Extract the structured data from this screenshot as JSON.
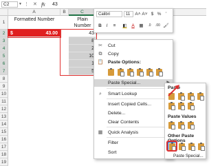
{
  "formula_bar": {
    "name_box": "C2",
    "fx": "fx",
    "value": "43"
  },
  "columns": [
    "A",
    "B",
    "C"
  ],
  "rows": [
    "1",
    "2",
    "3",
    "4",
    "5",
    "6",
    "7",
    "8",
    "9",
    "10",
    "11",
    "12",
    "13",
    "14",
    "15",
    "16",
    "17",
    "18",
    "19"
  ],
  "headers": {
    "formatted": "Formatted Number",
    "plain": "Plain Number"
  },
  "column_a": {
    "currency": "$",
    "value": "43.00"
  },
  "column_c_values": [
    "43",
    "8",
    "2",
    "10",
    "1",
    "5"
  ],
  "mini_toolbar": {
    "font": "Calibri",
    "size": "11",
    "buttons": [
      "A˄",
      "A˅",
      "$",
      "%",
      "’",
      "B",
      "I",
      "≡",
      "A",
      ".0"
    ]
  },
  "context_menu": {
    "items": [
      {
        "icon": "scissors-icon",
        "glyph": "✂",
        "label": "Cut"
      },
      {
        "icon": "copy-icon",
        "glyph": "⧉",
        "label": "Copy"
      }
    ],
    "paste_options_label": "Paste Options:",
    "paste_special": "Paste Special...",
    "items2": [
      {
        "icon": "smart-lookup-icon",
        "glyph": "⌕",
        "label": "Smart Lookup"
      },
      {
        "icon": "",
        "glyph": "",
        "label": "Insert Copied Cells..."
      },
      {
        "icon": "",
        "glyph": "",
        "label": "Delete..."
      },
      {
        "icon": "",
        "glyph": "",
        "label": "Clear Contents"
      },
      {
        "icon": "quick-analysis-icon",
        "glyph": "▦",
        "label": "Quick Analysis"
      },
      {
        "icon": "",
        "glyph": "",
        "label": "Filter",
        "submenu": true
      },
      {
        "icon": "",
        "glyph": "",
        "label": "Sort",
        "submenu": true
      }
    ]
  },
  "submenu": {
    "paste": "Paste",
    "paste_values": "Paste Values",
    "other_paste_options": "Other Paste Options",
    "footer": "Paste Special..."
  },
  "colors": {
    "accent": "#217346",
    "highlight_red": "#e03030",
    "cell_red": "#e02020",
    "icon_orange": "#d69a3a"
  }
}
